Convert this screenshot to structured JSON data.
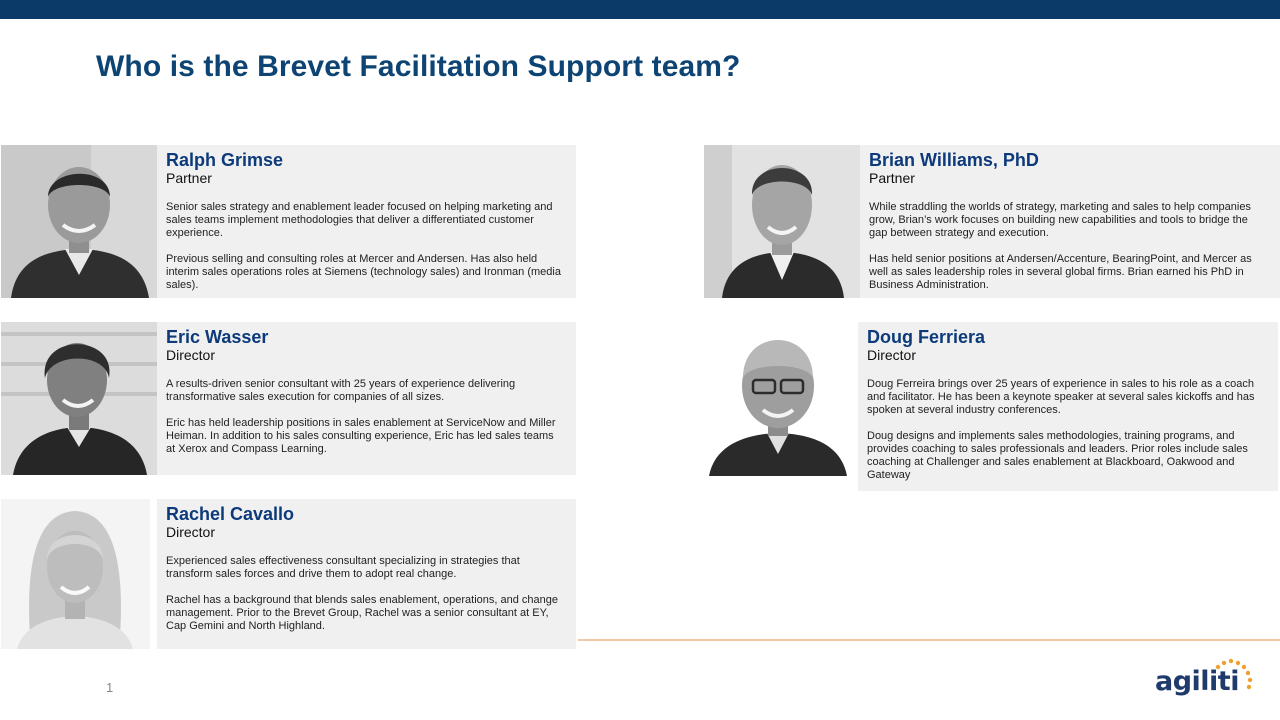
{
  "slide": {
    "title": "Who is the Brevet Facilitation Support team?",
    "page_number": "1"
  },
  "logo": {
    "text": "agiliti"
  },
  "colors": {
    "top_bar": "#0b3a68",
    "title": "#0d4473",
    "name": "#0d3a7a",
    "card_background": "#f0f0f0",
    "footer_line": "#f2c9a5",
    "logo_dots": "#f0a030"
  },
  "team": [
    {
      "name": "Ralph Grimse",
      "role": "Partner",
      "bio": [
        "Senior sales strategy and enablement leader focused on helping marketing and sales teams implement methodologies that deliver a differentiated customer experience.",
        "Previous selling and consulting roles at Mercer and Andersen. Has also held interim sales operations roles at Siemens (technology sales) and Ironman (media sales)."
      ]
    },
    {
      "name": "Brian Williams, PhD",
      "role": "Partner",
      "bio": [
        "While straddling the worlds of strategy, marketing and sales to help companies grow, Brian’s work focuses on building new capabilities and tools to bridge the gap between strategy and execution.",
        "Has held senior positions at Andersen/Accenture, BearingPoint, and Mercer as well as sales leadership roles in several global firms. Brian earned his PhD in Business Administration."
      ]
    },
    {
      "name": "Eric Wasser",
      "role": "Director",
      "bio": [
        "A results-driven senior consultant with 25 years of experience delivering transformative sales execution for companies of all sizes.",
        "Eric has held leadership positions in sales enablement at ServiceNow and Miller Heiman. In addition to his sales consulting experience, Eric has led sales teams at Xerox and Compass Learning."
      ]
    },
    {
      "name": "Doug Ferriera",
      "role": "Director",
      "bio": [
        "Doug Ferreira brings over 25 years of experience in sales to his role as a coach and facilitator. He has been a keynote speaker at several sales kickoffs and has spoken at several industry conferences.",
        "Doug designs and implements sales methodologies, training programs, and provides coaching to sales professionals and leaders. Prior roles include sales coaching at Challenger and sales enablement at Blackboard, Oakwood and Gateway"
      ]
    },
    {
      "name": "Rachel Cavallo",
      "role": "Director",
      "bio": [
        "Experienced sales effectiveness consultant specializing in strategies that transform sales forces and drive them to adopt real change.",
        "Rachel has a background that blends sales enablement, operations, and change management. Prior to the Brevet Group, Rachel was a senior consultant at EY, Cap Gemini and North Highland."
      ]
    }
  ]
}
